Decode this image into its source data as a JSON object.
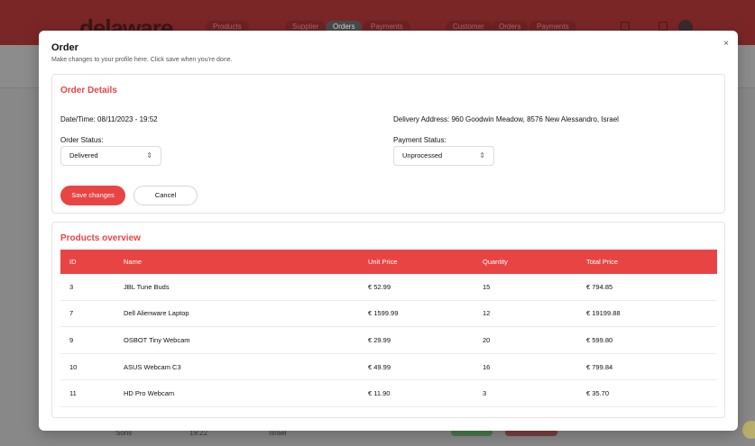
{
  "background": {
    "logo": "delaware",
    "nav": [
      "Products",
      "Supplier",
      "Orders",
      "Payments",
      "Customer",
      "Orders",
      "Payments"
    ],
    "row_texts": [
      "Sons",
      "19:22",
      "Israel"
    ]
  },
  "modal": {
    "title": "Order",
    "subtitle": "Make changes to your profile here. Click save when you're done.",
    "close": "×"
  },
  "details": {
    "title": "Order Details",
    "datetime": "Date/Time: 08/11/2023 - 19:52",
    "delivery": "Delivery Address: 960 Goodwin Meadow, 8576 New Alessandro, Israel",
    "order_status_label": "Order Status:",
    "order_status_value": "Delivered",
    "payment_status_label": "Payment Status:",
    "payment_status_value": "Unprocessed",
    "save_label": "Save changes",
    "cancel_label": "Cancel"
  },
  "products": {
    "title": "Products overview",
    "columns": [
      "ID",
      "Name",
      "Unit Price",
      "Quantity",
      "Total Price"
    ],
    "rows": [
      {
        "id": "3",
        "name": "JBL Tune Buds",
        "unit": "€ 52.99",
        "qty": "15",
        "total": "€ 794.85"
      },
      {
        "id": "7",
        "name": "Dell Alienware Laptop",
        "unit": "€ 1599.99",
        "qty": "12",
        "total": "€ 19199.88"
      },
      {
        "id": "9",
        "name": "OSBOT Tiny Webcam",
        "unit": "€ 29.99",
        "qty": "20",
        "total": "€ 599.80"
      },
      {
        "id": "10",
        "name": "ASUS Webcam C3",
        "unit": "€ 49.99",
        "qty": "16",
        "total": "€ 799.84"
      },
      {
        "id": "11",
        "name": "HD Pro Webcam",
        "unit": "€ 11.90",
        "qty": "3",
        "total": "€ 35.70"
      }
    ]
  },
  "colors": {
    "accent": "#e94444",
    "overlay": "#8a8a8a"
  },
  "icons": {
    "close": "close-icon",
    "chevron": "chevron-updown-icon"
  }
}
